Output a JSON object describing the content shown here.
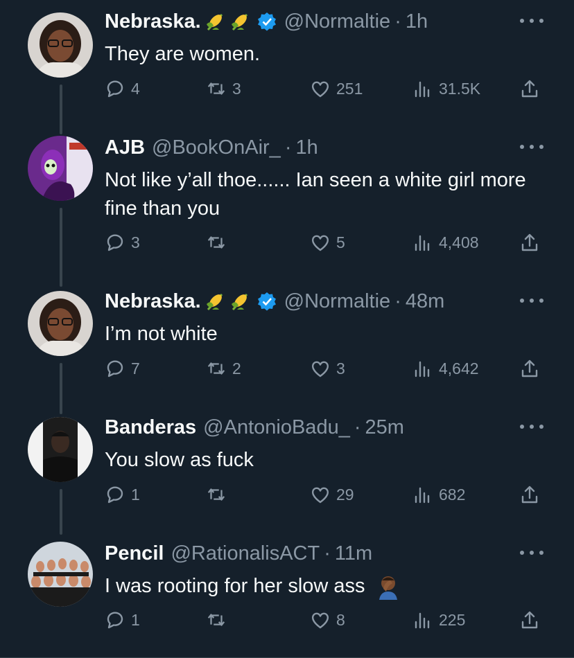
{
  "colors": {
    "background": "#15202b",
    "text_primary": "#f7f9f9",
    "text_secondary": "#8b98a5",
    "verified_blue": "#1d9bf0",
    "thread_line": "#38444d"
  },
  "tweets": [
    {
      "name": "Nebraska.",
      "name_emojis": [
        "corn-emoji",
        "corn-emoji"
      ],
      "verified": true,
      "handle": "@Normaltie",
      "time": "1h",
      "text": "They are women.",
      "replies": "4",
      "retweets": "3",
      "likes": "251",
      "views": "31.5K"
    },
    {
      "name": "AJB",
      "verified": false,
      "handle": "@BookOnAir_",
      "time": "1h",
      "text": "Not like y’all thoe...... Ian seen a white girl more fine than you",
      "replies": "3",
      "retweets": "",
      "likes": "5",
      "views": "4,408"
    },
    {
      "name": "Nebraska.",
      "name_emojis": [
        "corn-emoji",
        "corn-emoji"
      ],
      "verified": true,
      "handle": "@Normaltie",
      "time": "48m",
      "text": "I’m not white",
      "replies": "7",
      "retweets": "2",
      "likes": "3",
      "views": "4,642"
    },
    {
      "name": "Banderas",
      "verified": false,
      "handle": "@AntonioBadu_",
      "time": "25m",
      "text": "You slow as fuck",
      "replies": "1",
      "retweets": "",
      "likes": "29",
      "views": "682"
    },
    {
      "name": "Pencil",
      "verified": false,
      "handle": "@RationalisACT",
      "time": "11m",
      "text": "I was rooting for her slow ass",
      "text_emoji": "facepalm-emoji",
      "replies": "1",
      "retweets": "",
      "likes": "8",
      "views": "225"
    }
  ],
  "separator": "·"
}
